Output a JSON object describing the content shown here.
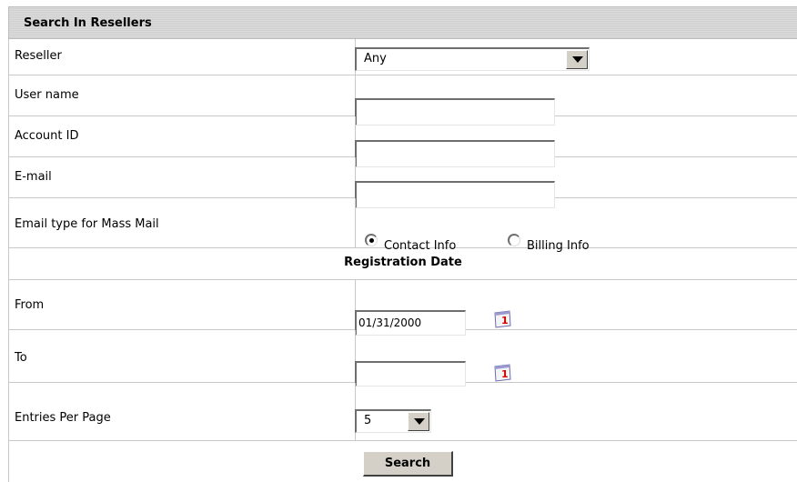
{
  "panel": {
    "title": "Search In Resellers"
  },
  "fields": {
    "reseller": {
      "label": "Reseller",
      "value": "Any"
    },
    "username": {
      "label": "User name",
      "value": ""
    },
    "account_id": {
      "label": "Account ID",
      "value": ""
    },
    "email": {
      "label": "E-mail",
      "value": ""
    },
    "email_type": {
      "label": "Email type for Mass Mail",
      "options": [
        "Contact Info",
        "Billing Info"
      ],
      "selected": "Contact Info"
    }
  },
  "registration": {
    "title": "Registration Date",
    "from": {
      "label": "From",
      "value": "01/31/2000"
    },
    "to": {
      "label": "To",
      "value": ""
    }
  },
  "entries": {
    "label": "Entries Per Page",
    "value": "5"
  },
  "actions": {
    "search_label": "Search"
  },
  "icons": {
    "calendar": "calendar-icon"
  },
  "colors": {
    "header_bg": "#d6d6d6",
    "border": "#c9c9c9",
    "button_bg": "#d4d0c8"
  }
}
